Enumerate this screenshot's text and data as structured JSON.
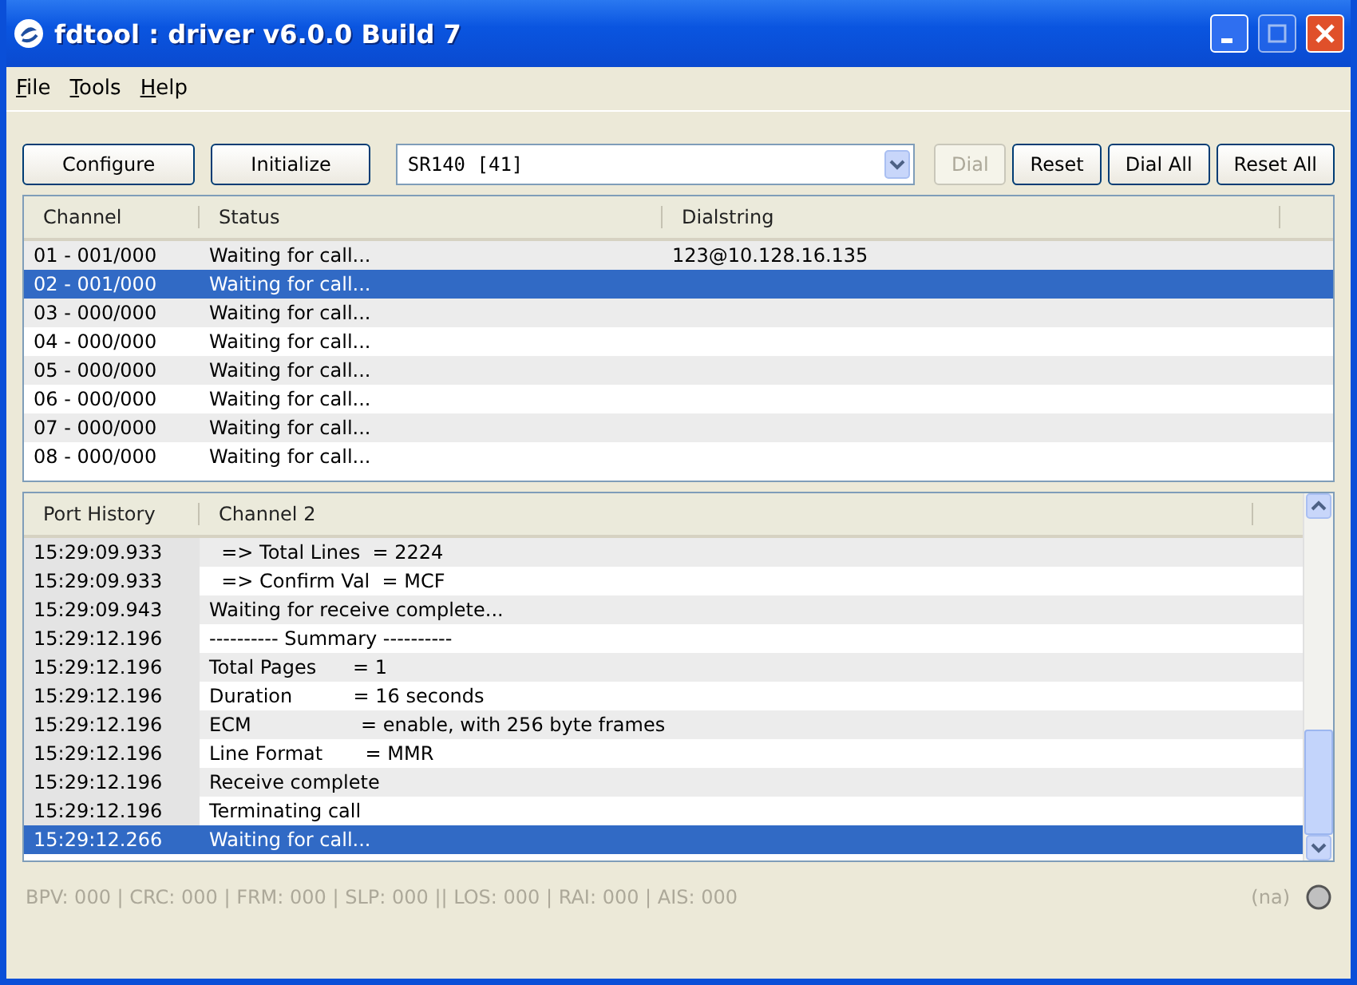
{
  "window": {
    "title": "fdtool : driver v6.0.0 Build 7"
  },
  "menu": [
    "File",
    "Tools",
    "Help"
  ],
  "toolbar": {
    "left_buttons": [
      {
        "label": "Configure",
        "disabled": false
      },
      {
        "label": "Initialize",
        "disabled": false
      }
    ],
    "device_select": {
      "value": "SR140 [41]"
    },
    "right_buttons": [
      {
        "label": "Dial",
        "disabled": true
      },
      {
        "label": "Reset",
        "disabled": false
      },
      {
        "label": "Dial All",
        "disabled": false
      },
      {
        "label": "Reset All",
        "disabled": false
      }
    ]
  },
  "channels_table": {
    "columns": [
      "Channel",
      "Status",
      "Dialstring"
    ],
    "rows": [
      {
        "channel": "01 - 001/000",
        "status": "Waiting for call...",
        "dialstring": "123@10.128.16.135",
        "selected": false
      },
      {
        "channel": "02 - 001/000",
        "status": "Waiting for call...",
        "dialstring": "",
        "selected": true
      },
      {
        "channel": "03 - 000/000",
        "status": "Waiting for call...",
        "dialstring": "",
        "selected": false
      },
      {
        "channel": "04 - 000/000",
        "status": "Waiting for call...",
        "dialstring": "",
        "selected": false
      },
      {
        "channel": "05 - 000/000",
        "status": "Waiting for call...",
        "dialstring": "",
        "selected": false
      },
      {
        "channel": "06 - 000/000",
        "status": "Waiting for call...",
        "dialstring": "",
        "selected": false
      },
      {
        "channel": "07 - 000/000",
        "status": "Waiting for call...",
        "dialstring": "",
        "selected": false
      },
      {
        "channel": "08 - 000/000",
        "status": "Waiting for call...",
        "dialstring": "",
        "selected": false
      }
    ]
  },
  "history_table": {
    "columns": [
      "Port History",
      "Channel 2"
    ],
    "rows": [
      {
        "time": "15:29:09.933",
        "message": "  => Total Lines  = 2224",
        "selected": false
      },
      {
        "time": "15:29:09.933",
        "message": "  => Confirm Val  = MCF",
        "selected": false
      },
      {
        "time": "15:29:09.943",
        "message": "Waiting for receive complete...",
        "selected": false
      },
      {
        "time": "15:29:12.196",
        "message": "---------- Summary ----------",
        "selected": false
      },
      {
        "time": "15:29:12.196",
        "message": "Total Pages      = 1",
        "selected": false
      },
      {
        "time": "15:29:12.196",
        "message": "Duration          = 16 seconds",
        "selected": false
      },
      {
        "time": "15:29:12.196",
        "message": "ECM                  = enable, with 256 byte frames",
        "selected": false
      },
      {
        "time": "15:29:12.196",
        "message": "Line Format       = MMR",
        "selected": false
      },
      {
        "time": "15:29:12.196",
        "message": "Receive complete",
        "selected": false
      },
      {
        "time": "15:29:12.196",
        "message": "Terminating call",
        "selected": false
      },
      {
        "time": "15:29:12.266",
        "message": "Waiting for call...",
        "selected": true
      }
    ]
  },
  "status_bar": {
    "counters": "BPV: 000 | CRC: 000 | FRM: 000 | SLP: 000 || LOS: 000 | RAI: 000 | AIS: 000",
    "state": "(na)"
  }
}
